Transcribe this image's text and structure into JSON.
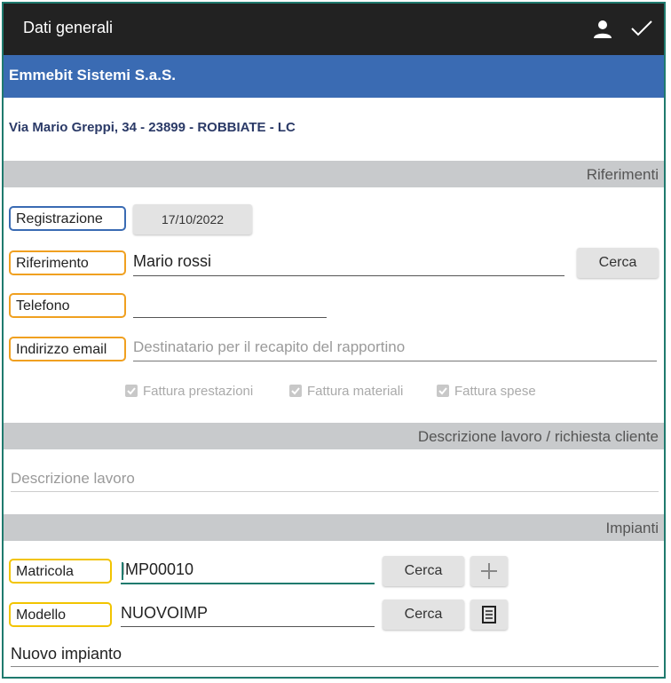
{
  "topbar": {
    "title": "Dati generali",
    "icons": [
      "user-icon",
      "check-icon"
    ]
  },
  "company": {
    "name": "Emmebit Sistemi S.a.S.",
    "address": "Via Mario Greppi, 34 - 23899 - ROBBIATE - LC"
  },
  "sections": {
    "riferimenti": "Riferimenti",
    "descrizione": "Descrizione lavoro / richiesta cliente",
    "impianti": "Impianti"
  },
  "riferimenti": {
    "registrazione_label": "Registrazione",
    "registrazione_date": "17/10/2022",
    "riferimento_label": "Riferimento",
    "riferimento_value": "Mario rossi",
    "cerca_label": "Cerca",
    "telefono_label": "Telefono",
    "telefono_value": "",
    "email_label": "Indirizzo email",
    "email_placeholder": "Destinatario per il recapito del rapportino",
    "checkboxes": [
      "Fattura prestazioni",
      "Fattura materiali",
      "Fattura spese"
    ]
  },
  "descrizione": {
    "placeholder": "Descrizione lavoro"
  },
  "impianti": {
    "matricola_label": "Matricola",
    "matricola_value": "IMP00010",
    "modello_label": "Modello",
    "modello_value": "NUOVOIMP",
    "cerca_label": "Cerca",
    "add_icon": "plus-icon",
    "list_icon": "list-icon",
    "nuovo_impianto": "Nuovo impianto"
  },
  "colors": {
    "topbar": "#222222",
    "company_bar": "#3a6bb3",
    "section_bar": "#c8cacc",
    "accent": "#1f7a6e",
    "label_blue": "#3a6bb3",
    "label_orange": "#f0a020",
    "label_yellow": "#f2c400"
  }
}
